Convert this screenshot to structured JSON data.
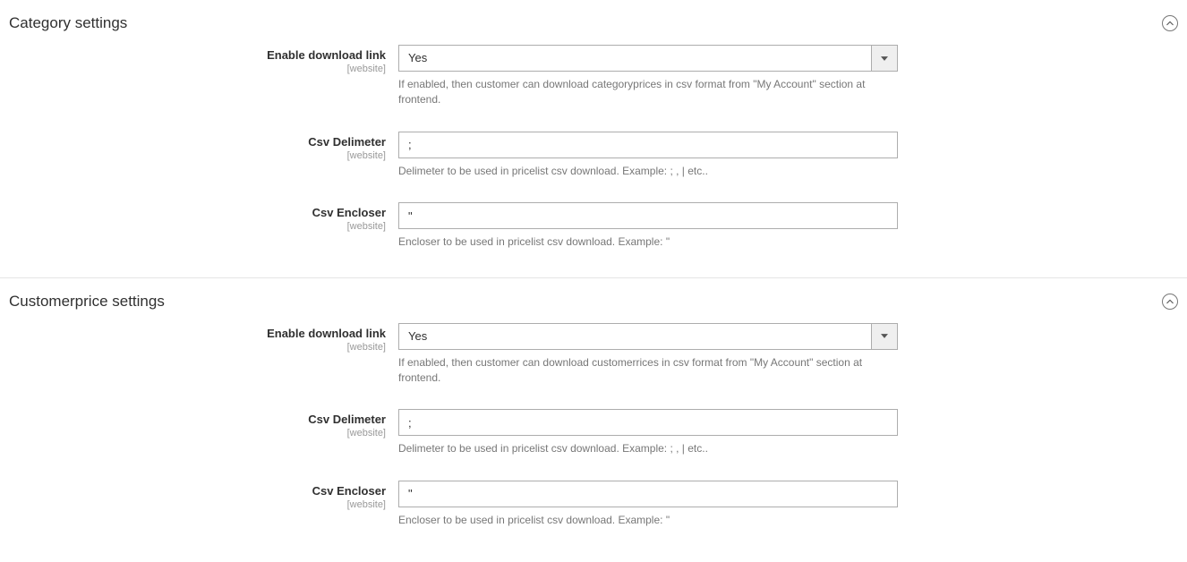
{
  "scope_label": "[website]",
  "category": {
    "title": "Category settings",
    "enable": {
      "label": "Enable download link",
      "value": "Yes",
      "hint": "If enabled, then customer can download categoryprices in csv format from \"My Account\" section at frontend."
    },
    "delimiter": {
      "label": "Csv Delimeter",
      "value": ";",
      "hint": "Delimeter to be used in pricelist csv download. Example: ; , | etc.."
    },
    "encloser": {
      "label": "Csv Encloser",
      "value": "\"",
      "hint": "Encloser to be used in pricelist csv download. Example: \""
    }
  },
  "customer": {
    "title": "Customerprice settings",
    "enable": {
      "label": "Enable download link",
      "value": "Yes",
      "hint": "If enabled, then customer can download customerrices in csv format from \"My Account\" section at frontend."
    },
    "delimiter": {
      "label": "Csv Delimeter",
      "value": ";",
      "hint": "Delimeter to be used in pricelist csv download. Example: ; , | etc.."
    },
    "encloser": {
      "label": "Csv Encloser",
      "value": "\"",
      "hint": "Encloser to be used in pricelist csv download. Example: \""
    }
  }
}
